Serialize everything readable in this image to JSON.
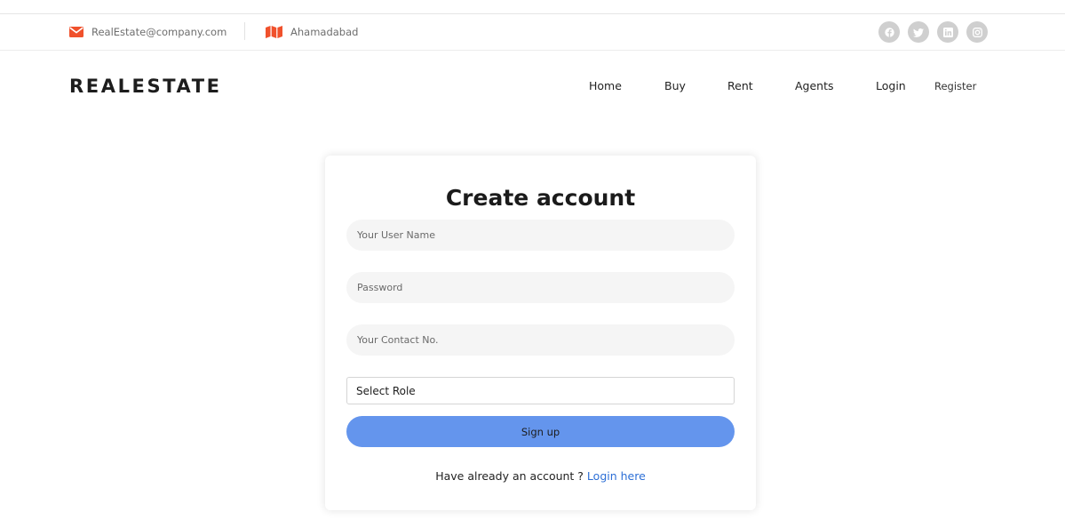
{
  "colors": {
    "accent_orange": "#f0512c",
    "signup_blue": "#6495ed",
    "link_blue": "#2d6fd6",
    "social_gray": "#cfcfcf"
  },
  "topbar": {
    "email": "RealEstate@company.com",
    "email_icon": "envelope-icon",
    "location": "Ahamadabad",
    "location_icon": "map-icon",
    "socials": [
      "facebook-icon",
      "twitter-icon",
      "linkedin-icon",
      "instagram-icon"
    ]
  },
  "navbar": {
    "brand": "REALESTATE",
    "links": {
      "home": "Home",
      "buy": "Buy",
      "rent": "Rent",
      "agents": "Agents",
      "login": "Login",
      "register": "Register"
    }
  },
  "form": {
    "title": "Create account",
    "username_placeholder": "Your User Name",
    "password_placeholder": "Password",
    "contact_placeholder": "Your Contact No.",
    "role_selected": "Select Role",
    "signup_label": "Sign up",
    "login_prompt": "Have already an account ? ",
    "login_link": "Login here"
  }
}
